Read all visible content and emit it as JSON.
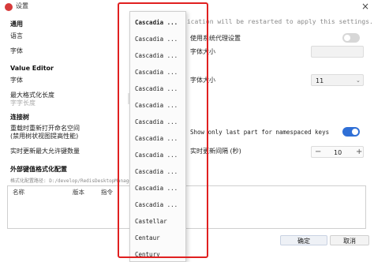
{
  "window": {
    "title": "设置",
    "close_glyph": "×"
  },
  "notice": "lication will be restarted to apply this settings.",
  "left": {
    "general_head": "通用",
    "language_label": "语言",
    "font_label": "字体",
    "value_editor_head": "Value Editor",
    "ve_font_label": "字体",
    "max_format_len_label": "最大格式化长度",
    "font_len_label": "字字长度",
    "connection_head": "连接树",
    "reopen_ns_label": "重载时重新打开命名空间",
    "reopen_ns_sub": "(禁用树状视图提高性能)",
    "realtime_max_label": "实时更新最大允许键数量",
    "ext_format_head": "外部键值格式化配置",
    "ext_format_path": "格式化配置路径: D:/develop/RedisDesktopManager/..."
  },
  "right": {
    "proxy_label": "使用系统代理设置",
    "font_size_label": "字体大小",
    "ve_font_size_label": "字体大小",
    "ve_font_size_value": "11",
    "namespace_label": "Show only last part for namespaced keys",
    "realtime_interval_label": "实时更新间隔 (秒)",
    "realtime_interval_value": "10",
    "minus": "−",
    "plus": "+"
  },
  "toggles": {
    "proxy": false,
    "namespace_last_part": true
  },
  "table": {
    "headers": [
      "名称",
      "版本",
      "指令"
    ]
  },
  "buttons": {
    "ok": "确定",
    "cancel": "取消"
  },
  "dropdown": {
    "options": [
      "Cascadia ...",
      "Cascadia ...",
      "Cascadia ...",
      "Cascadia ...",
      "Cascadia ...",
      "Cascadia ...",
      "Cascadia ...",
      "Cascadia ...",
      "Cascadia ...",
      "Cascadia ...",
      "Cascadia ...",
      "Cascadia ...",
      "Castellar",
      "Centaur",
      "Century"
    ],
    "selected_index": 0
  },
  "colors": {
    "accent": "#2f6fd6",
    "highlight_frame": "#e02020"
  }
}
